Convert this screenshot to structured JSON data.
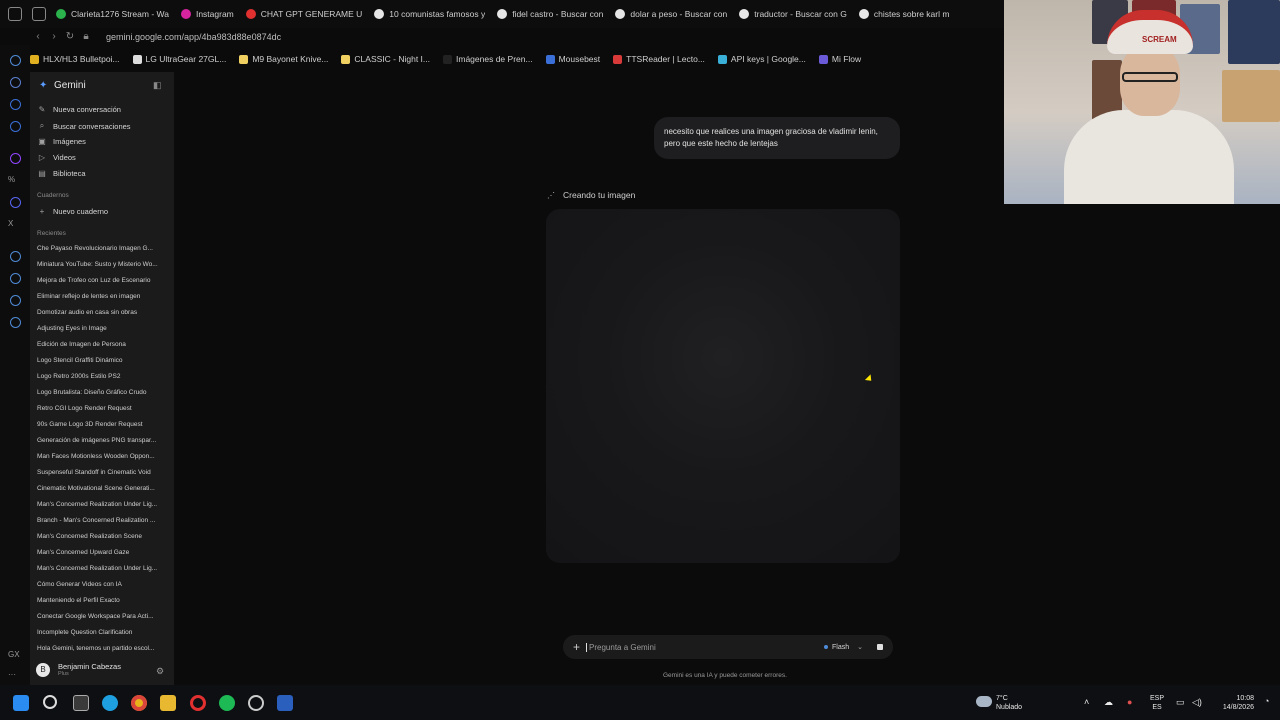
{
  "browser": {
    "tabs": [
      {
        "label": "Clarieta1276 Stream - Wa",
        "color": "#2bb24c"
      },
      {
        "label": "Instagram",
        "color": "#d6249f"
      },
      {
        "label": "CHAT GPT GENERAME U",
        "color": "#e03030"
      },
      {
        "label": "10 comunistas famosos y",
        "color": "#e6e6e6"
      },
      {
        "label": "fidel castro - Buscar con",
        "color": "#e6e6e6"
      },
      {
        "label": "dolar a peso - Buscar con",
        "color": "#e6e6e6"
      },
      {
        "label": "traductor - Buscar con G",
        "color": "#e6e6e6"
      },
      {
        "label": "chistes sobre karl m",
        "color": "#e6e6e6"
      }
    ],
    "url": "gemini.google.com/app/4ba983d88e0874dc",
    "bookmarks": [
      {
        "label": "HLX/HL3 Bulletpoi...",
        "color": "#e0b020"
      },
      {
        "label": "LG UltraGear 27GL...",
        "color": "#dddddd"
      },
      {
        "label": "M9 Bayonet Knive...",
        "color": "#f0d060"
      },
      {
        "label": "CLASSIC - Night I...",
        "color": "#f0d060"
      },
      {
        "label": "Imágenes de Pren...",
        "color": "#222222"
      },
      {
        "label": "Mousebest",
        "color": "#3a6fd8"
      },
      {
        "label": "TTSReader | Lecto...",
        "color": "#d83a3a"
      },
      {
        "label": "API keys | Google...",
        "color": "#3ab0d8"
      },
      {
        "label": "Mi Flow",
        "color": "#6a5ad8"
      }
    ]
  },
  "sidebar": {
    "title": "Gemini",
    "nav": [
      {
        "label": "Nueva conversación",
        "icon": "new-chat-icon",
        "glyph": "✎"
      },
      {
        "label": "Buscar conversaciones",
        "icon": "search-icon",
        "glyph": "⌕"
      },
      {
        "label": "Imágenes",
        "icon": "image-icon",
        "glyph": "▣"
      },
      {
        "label": "Videos",
        "icon": "video-icon",
        "glyph": "▷"
      },
      {
        "label": "Biblioteca",
        "icon": "library-icon",
        "glyph": "▤"
      }
    ],
    "notebooks_label": "Cuadernos",
    "new_notebook": "Nuevo cuaderno",
    "recents_label": "Recientes",
    "recents": [
      "Che Payaso Revolucionario Imagen G...",
      "Miniatura YouTube: Susto y Misterio Wo...",
      "Mejora de Trofeo con Luz de Escenario",
      "Eliminar reflejo de lentes en imagen",
      "Domotizar audio en casa sin obras",
      "Adjusting Eyes in Image",
      "Edición de Imagen de Persona",
      "Logo Stencil Graffiti Dinámico",
      "Logo Retro 2000s Estilo PS2",
      "Logo Brutalista: Diseño Gráfico Crudo",
      "Retro CGI Logo Render Request",
      "90s Game Logo 3D Render Request",
      "Generación de imágenes PNG transpar...",
      "Man Faces Motionless Wooden Oppon...",
      "Suspenseful Standoff in Cinematic Void",
      "Cinematic Motivational Scene Generati...",
      "Man's Concerned Realization Under Lig...",
      "Branch - Man's Concerned Realization ...",
      "Man's Concerned Realization Scene",
      "Man's Concerned Upward Gaze",
      "Man's Concerned Realization Under Lig...",
      "Cómo Generar Videos con IA",
      "Manteniendo el Perfil Exacto",
      "Conectar Google Workspace Para Acti...",
      "Incomplete Question Clarification",
      "Hola Gemini, tenemos un partido escol..."
    ],
    "user": {
      "name": "Benjamin Cabezas",
      "plan": "Plus",
      "initial": "B"
    }
  },
  "chat": {
    "user_message": "necesito que realices una imagen graciosa de vladimir lenin, pero que este hecho de lentejas",
    "status": "Creando tu imagen",
    "composer_placeholder": "Pregunta a Gemini",
    "model": "Flash",
    "disclaimer": "Gemini es una IA y puede cometer errores."
  },
  "webcam": {
    "poster_text": "SCREAM"
  },
  "taskbar": {
    "weather_temp": "7°C",
    "weather_desc": "Nublado",
    "lang": "ESP",
    "lang_sub": "ES",
    "time": "10:08",
    "date": "14/8/2026"
  }
}
